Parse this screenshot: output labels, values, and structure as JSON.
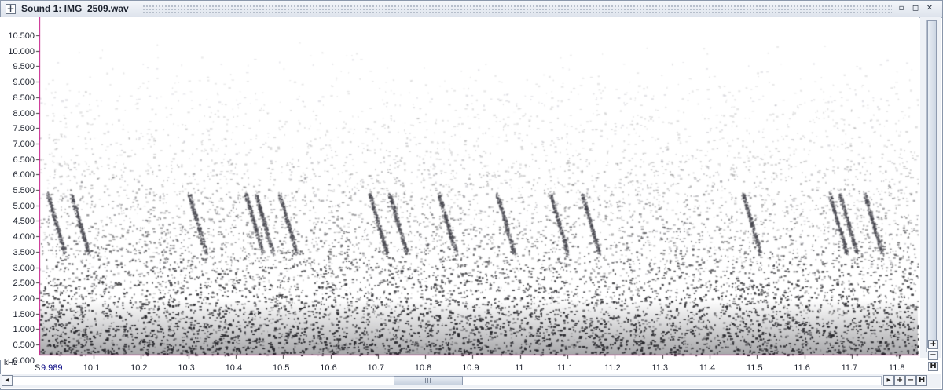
{
  "window": {
    "title": "Sound 1: IMG_2509.wav",
    "iconify_glyph": "▫",
    "maximize_glyph": "◻",
    "close_glyph": "✕",
    "title_icon": "+"
  },
  "spectrogram": {
    "unit_label": "kHz",
    "selection_marker": "S",
    "start_time": "9.989",
    "y_ticks": [
      "10.500",
      "10.000",
      "9.500",
      "9.000",
      "8.500",
      "8.000",
      "7.500",
      "7.000",
      "6.500",
      "6.000",
      "5.500",
      "5.000",
      "4.500",
      "4.000",
      "3.500",
      "3.000",
      "2.500",
      "2.000",
      "1.500",
      "1.000",
      "0.500",
      "0.000"
    ],
    "x_ticks": [
      "10.1",
      "10.2",
      "10.3",
      "10.4",
      "10.5",
      "10.6",
      "10.7",
      "10.8",
      "10.9",
      "11",
      "11.1",
      "11.2",
      "11.3",
      "11.4",
      "11.5",
      "11.6",
      "11.7",
      "11.8"
    ],
    "colors": {
      "axis": "#c0007a",
      "background": "#ffffff",
      "ink": "#2a2a2e"
    }
  },
  "scrollbars": {
    "left_arrow": "◂",
    "right_arrow": "▸",
    "zoom_in": "+",
    "zoom_out": "−",
    "fit": "H"
  }
}
